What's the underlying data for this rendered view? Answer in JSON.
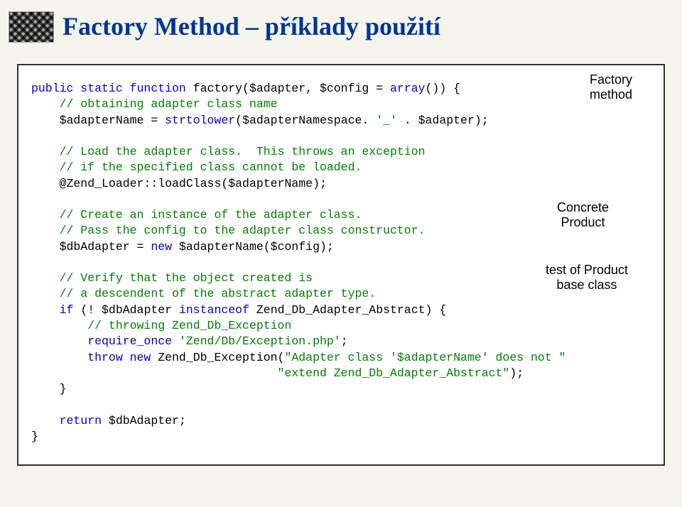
{
  "title": "Factory Method – příklady použití",
  "annotations": {
    "factory_method_l1": "Factory",
    "factory_method_l2": "method",
    "concrete_product_l1": "Concrete",
    "concrete_product_l2": "Product",
    "test_product_l1": "test of Product",
    "test_product_l2": "base class"
  },
  "code": {
    "l01a": "public static function ",
    "l01b": "factory($adapter, $config = ",
    "l01c": "array",
    "l01d": "()) {",
    "l02": "    // obtaining adapter class name",
    "l03a": "    $adapterName = ",
    "l03b": "strtolower",
    "l03c": "($adapterNamespace. ",
    "l03d": "'_'",
    "l03e": " . $adapter);",
    "lblank1": "",
    "l04": "    // Load the adapter class.  This throws an exception",
    "l05": "    // if the specified class cannot be loaded.",
    "l06": "    @Zend_Loader::loadClass($adapterName);",
    "lblank2": "",
    "l07": "    // Create an instance of the adapter class.",
    "l08": "    // Pass the config to the adapter class constructor.",
    "l09a": "    $dbAdapter = ",
    "l09b": "new",
    "l09c": " $adapterName($config);",
    "lblank3": "",
    "l10": "    // Verify that the object created is",
    "l11": "    // a descendent of the abstract adapter type.",
    "l12a": "    if",
    "l12b": " (! $dbAdapter ",
    "l12c": "instanceof",
    "l12d": " Zend_Db_Adapter_Abstract) {",
    "l13": "        // throwing Zend_Db_Exception",
    "l14a": "        require_once ",
    "l14b": "'Zend/Db/Exception.php'",
    "l14c": ";",
    "l15a": "        throw new",
    "l15b": " Zend_Db_Exception(",
    "l15c": "\"Adapter class '$adapterName' does not \"",
    "l16": "                                   \"extend Zend_Db_Adapter_Abstract\"",
    "l16b": ");",
    "l17": "    }",
    "lblank4": "",
    "l18a": "    return",
    "l18b": " $dbAdapter;",
    "l19": "}"
  }
}
